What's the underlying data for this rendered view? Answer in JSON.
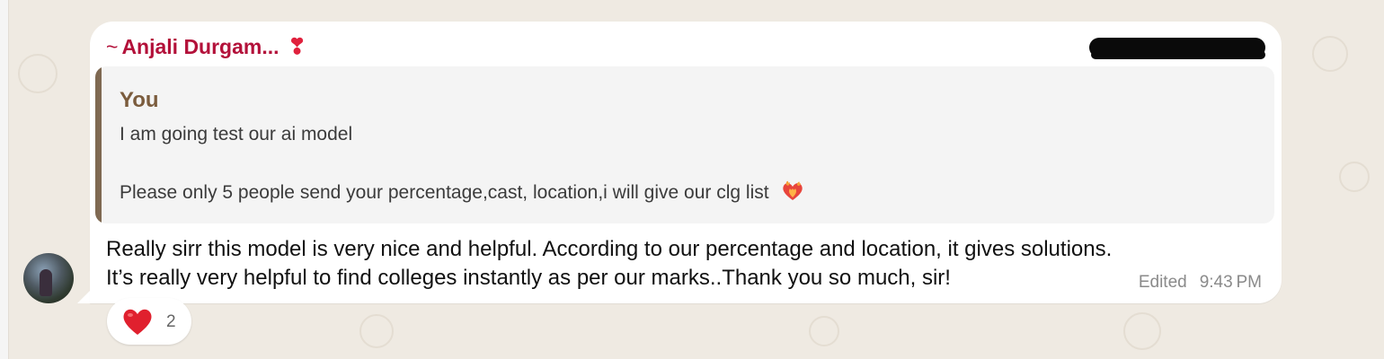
{
  "message": {
    "sender_tilde": "~",
    "sender_name": "Anjali Durgam...",
    "sender_emoji": "❣",
    "quote": {
      "author": "You",
      "line1": "I am going test our ai model",
      "line2": "Please only 5 people send your percentage,cast, location,i will give our clg list",
      "line2_emoji_icon": "heart-on-fire-icon"
    },
    "text_line1": "Really sirr this model is very nice and helpful. According to our percentage and location, it gives solutions.",
    "text_line2": "It’s really very helpful to find colleges instantly as per our marks..Thank you so much, sir!",
    "edited_label": "Edited",
    "time": "9:43 PM"
  },
  "reaction": {
    "icon": "red-heart-icon",
    "count": "2"
  },
  "colors": {
    "sender": "#b3113a",
    "quote_author": "#7b5c3d",
    "quote_bar": "#7f6952",
    "background": "#efeae2"
  }
}
